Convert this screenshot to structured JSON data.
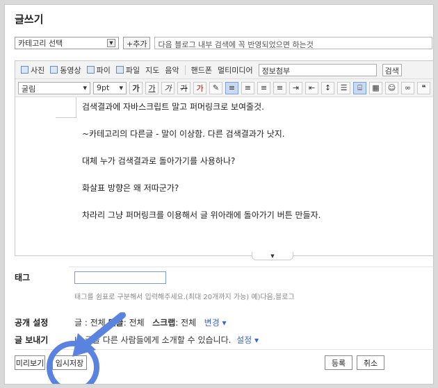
{
  "page_title": "글쓰기",
  "category": {
    "selected": "카테고리 선택",
    "add_label": "+추가"
  },
  "title_input": {
    "value": "다음 블로그 내부 검색에 꼭 반영되었으면 하는것"
  },
  "toolbar1": {
    "items": [
      "사진",
      "동영상",
      "파이",
      "파일",
      "지도",
      "음악",
      "핸드폰",
      "멀티미디어"
    ],
    "info_select": "정보첨부",
    "search_label": "검색"
  },
  "toolbar2": {
    "font": "굴림",
    "size": "9pt",
    "format_buttons": [
      "가",
      "가",
      "가",
      "가",
      "가"
    ]
  },
  "content": {
    "paragraphs": [
      "검색결과에 자바스크립트 말고 퍼머링크로 보여줄것.",
      "~카테고리의 다른글 - 말이 이상함. 다른 검색결과가 낫지.",
      "대체 누가 검색결과로 돌아가기를 사용하나?",
      "화살표 방향은 왜 저따군가?",
      "차라리 그냥 퍼머링크를 이용해서 글 위아래에 돌아가기 버튼 만들자."
    ]
  },
  "tag": {
    "label": "태그",
    "help": "태그를 쉼표로 구분해서 입력해주세요.(최대 20개까지 가능) 예)다음,블로그"
  },
  "visibility": {
    "label": "공개 설정",
    "text_prefix": "글 : 전체",
    "comment_label": "댓글",
    "comment_value": ": 전체",
    "scrap_label": "스크랩",
    "scrap_value": ": 전체",
    "change_label": "변경 ▾"
  },
  "send": {
    "label": "글 보내기",
    "text": "내 글을 다른 사람들에게 소개할 수 있습니다.",
    "settings_label": "설정 ▾"
  },
  "buttons": {
    "preview": "미리보기",
    "temp_save": "임시저장",
    "submit": "등록",
    "cancel": "취소"
  },
  "colors": {
    "accent": "#5a83e0",
    "link": "#3b66c4"
  }
}
